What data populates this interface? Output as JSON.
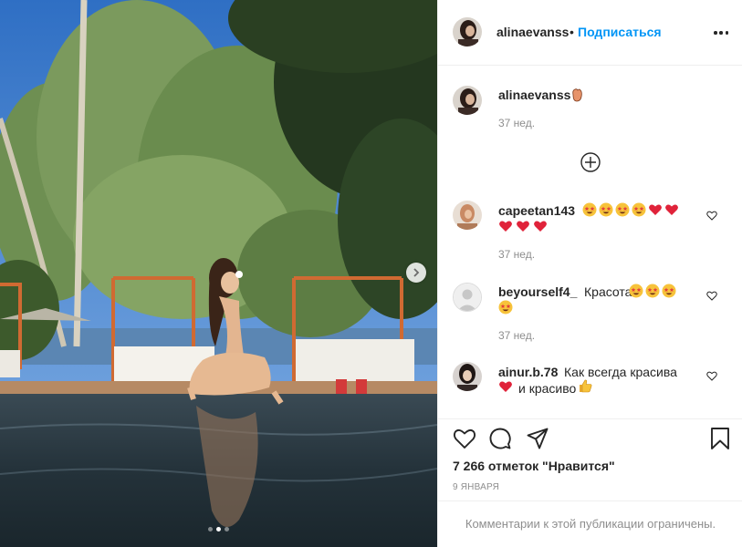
{
  "header": {
    "username": "alinaevanss",
    "separator": "•",
    "follow_label": "Подписаться"
  },
  "caption": {
    "username": "alinaevanss",
    "emoji": "hand-emoji",
    "time": "37 нед."
  },
  "comments": [
    {
      "username": "capeetan143",
      "emojis": [
        "star-struck",
        "star-struck",
        "star-struck",
        "star-struck",
        "red-heart",
        "red-heart",
        "red-heart",
        "red-heart",
        "red-heart"
      ],
      "time": "37 нед."
    },
    {
      "username": "beyourself4_",
      "text": "Красота",
      "emojis": [
        "star-struck",
        "star-struck",
        "star-struck",
        "star-struck"
      ],
      "time": "37 нед."
    },
    {
      "username": "ainur.b.78",
      "text_1": "Как всегда красива",
      "text_2": "и красиво",
      "emojis": [
        "red-heart",
        "thumbs-up"
      ]
    }
  ],
  "actions": [
    "like-icon",
    "comment-icon",
    "share-icon",
    "save-icon"
  ],
  "likes_text": "7 266 отметок \"Нравится\"",
  "date": "9 ЯНВАРЯ",
  "comments_restricted": "Комментарии к этой публикации ограничены.",
  "carousel": {
    "total": 3,
    "active_index": 1
  },
  "colors": {
    "link": "#0095f6",
    "text": "#262626",
    "muted": "#8e8e8e",
    "border": "#efefef"
  }
}
